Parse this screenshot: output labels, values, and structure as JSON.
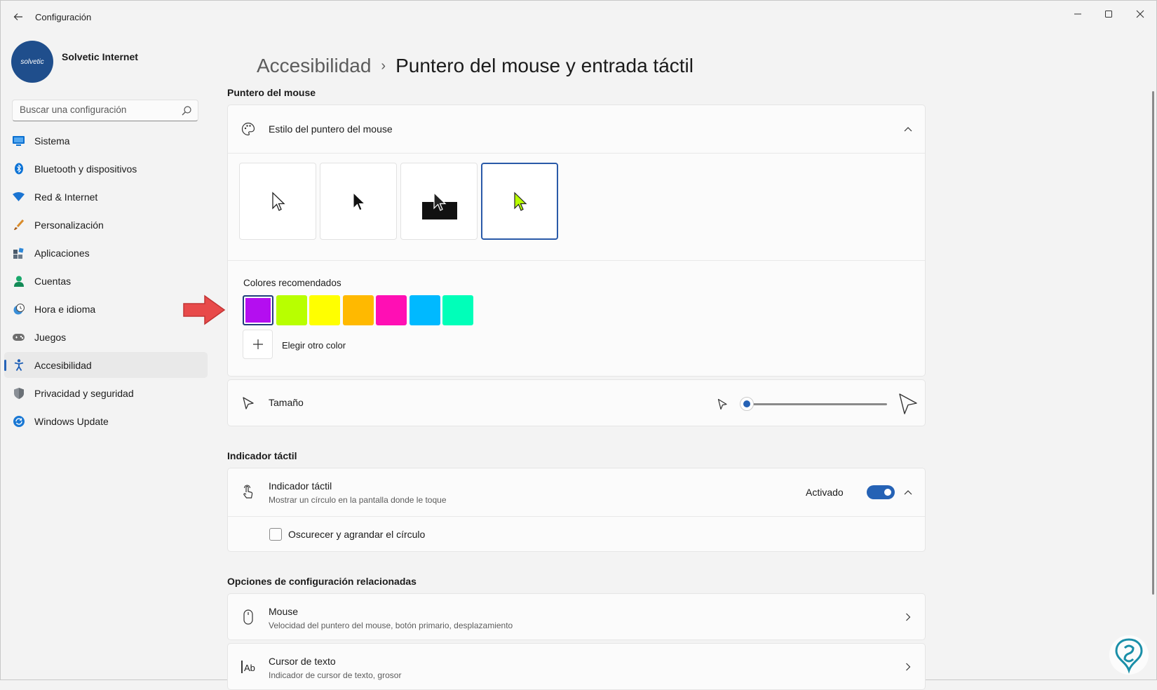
{
  "window": {
    "title": "Configuración",
    "controls": [
      "minimize",
      "maximize",
      "close"
    ]
  },
  "user": {
    "name": "Solvetic Internet",
    "avatar_text": "solvetic"
  },
  "search": {
    "placeholder": "Buscar una configuración"
  },
  "sidebar": {
    "items": [
      {
        "label": "Sistema",
        "icon": "system-icon"
      },
      {
        "label": "Bluetooth y dispositivos",
        "icon": "bluetooth-icon"
      },
      {
        "label": "Red & Internet",
        "icon": "wifi-icon"
      },
      {
        "label": "Personalización",
        "icon": "brush-icon"
      },
      {
        "label": "Aplicaciones",
        "icon": "apps-icon"
      },
      {
        "label": "Cuentas",
        "icon": "person-icon"
      },
      {
        "label": "Hora e idioma",
        "icon": "clock-globe-icon"
      },
      {
        "label": "Juegos",
        "icon": "gamepad-icon"
      },
      {
        "label": "Accesibilidad",
        "icon": "accessibility-icon",
        "active": true
      },
      {
        "label": "Privacidad y seguridad",
        "icon": "shield-icon"
      },
      {
        "label": "Windows Update",
        "icon": "update-icon"
      }
    ]
  },
  "breadcrumb": {
    "parent": "Accesibilidad",
    "separator": "›",
    "current": "Puntero del mouse y entrada táctil"
  },
  "pointer_section": {
    "title": "Puntero del mouse",
    "style_card": {
      "title": "Estilo del puntero del mouse",
      "styles": [
        "white",
        "black",
        "inverted",
        "custom"
      ],
      "selected_style": "custom"
    },
    "colors": {
      "label": "Colores recomendados",
      "swatches": [
        "#b40ef0",
        "#b8ff00",
        "#ffff00",
        "#ffb900",
        "#ff0fb4",
        "#00b9ff",
        "#00ffb9"
      ],
      "selected": "#b40ef0",
      "other_label": "Elegir otro color"
    },
    "size": {
      "label": "Tamaño",
      "value": 1,
      "min": 1,
      "max": 15
    }
  },
  "touch_section": {
    "title": "Indicador táctil",
    "row": {
      "title": "Indicador táctil",
      "subtitle": "Mostrar un círculo en la pantalla donde le toque",
      "state_label": "Activado",
      "on": true
    },
    "option": {
      "label": "Oscurecer y agrandar el círculo",
      "checked": false
    }
  },
  "related_section": {
    "title": "Opciones de configuración relacionadas",
    "rows": [
      {
        "title": "Mouse",
        "subtitle": "Velocidad del puntero del mouse, botón primario, desplazamiento"
      },
      {
        "title": "Cursor de texto",
        "subtitle": "Indicador de cursor de texto, grosor"
      }
    ]
  },
  "accent_color": "#2562b5"
}
